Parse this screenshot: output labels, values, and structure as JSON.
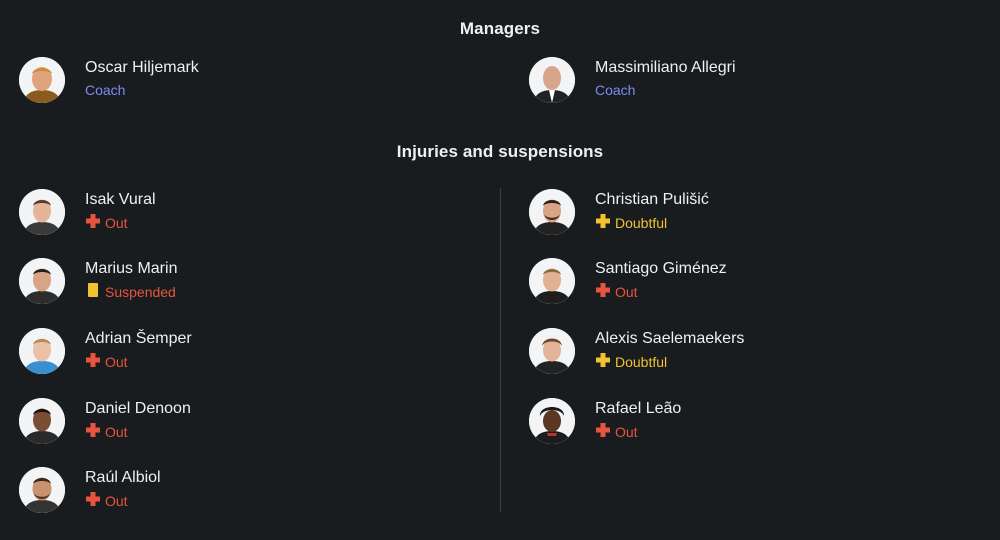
{
  "managers": {
    "title": "Managers",
    "items": [
      {
        "name": "Oscar Hiljemark",
        "role": "Coach"
      },
      {
        "name": "Massimiliano Allegri",
        "role": "Coach"
      }
    ]
  },
  "injuries": {
    "title": "Injuries and suspensions",
    "left": [
      {
        "name": "Isak Vural",
        "status": "Out"
      },
      {
        "name": "Marius Marin",
        "status": "Suspended"
      },
      {
        "name": "Adrian Šemper",
        "status": "Out"
      },
      {
        "name": "Daniel Denoon",
        "status": "Out"
      },
      {
        "name": "Raúl Albiol",
        "status": "Out"
      }
    ],
    "right": [
      {
        "name": "Christian Pulišić",
        "status": "Doubtful"
      },
      {
        "name": "Santiago Giménez",
        "status": "Out"
      },
      {
        "name": "Alexis Saelemaekers",
        "status": "Doubtful"
      },
      {
        "name": "Rafael Leão",
        "status": "Out"
      }
    ]
  },
  "colors": {
    "background": "#181c1f",
    "coach": "#7c8cf6",
    "out": "#e8543f",
    "doubtful": "#f2c230",
    "suspended_card": "#f2c230"
  },
  "icons": {
    "out": "red-cross-icon",
    "doubtful": "yellow-cross-icon",
    "suspended": "yellow-card-icon"
  }
}
